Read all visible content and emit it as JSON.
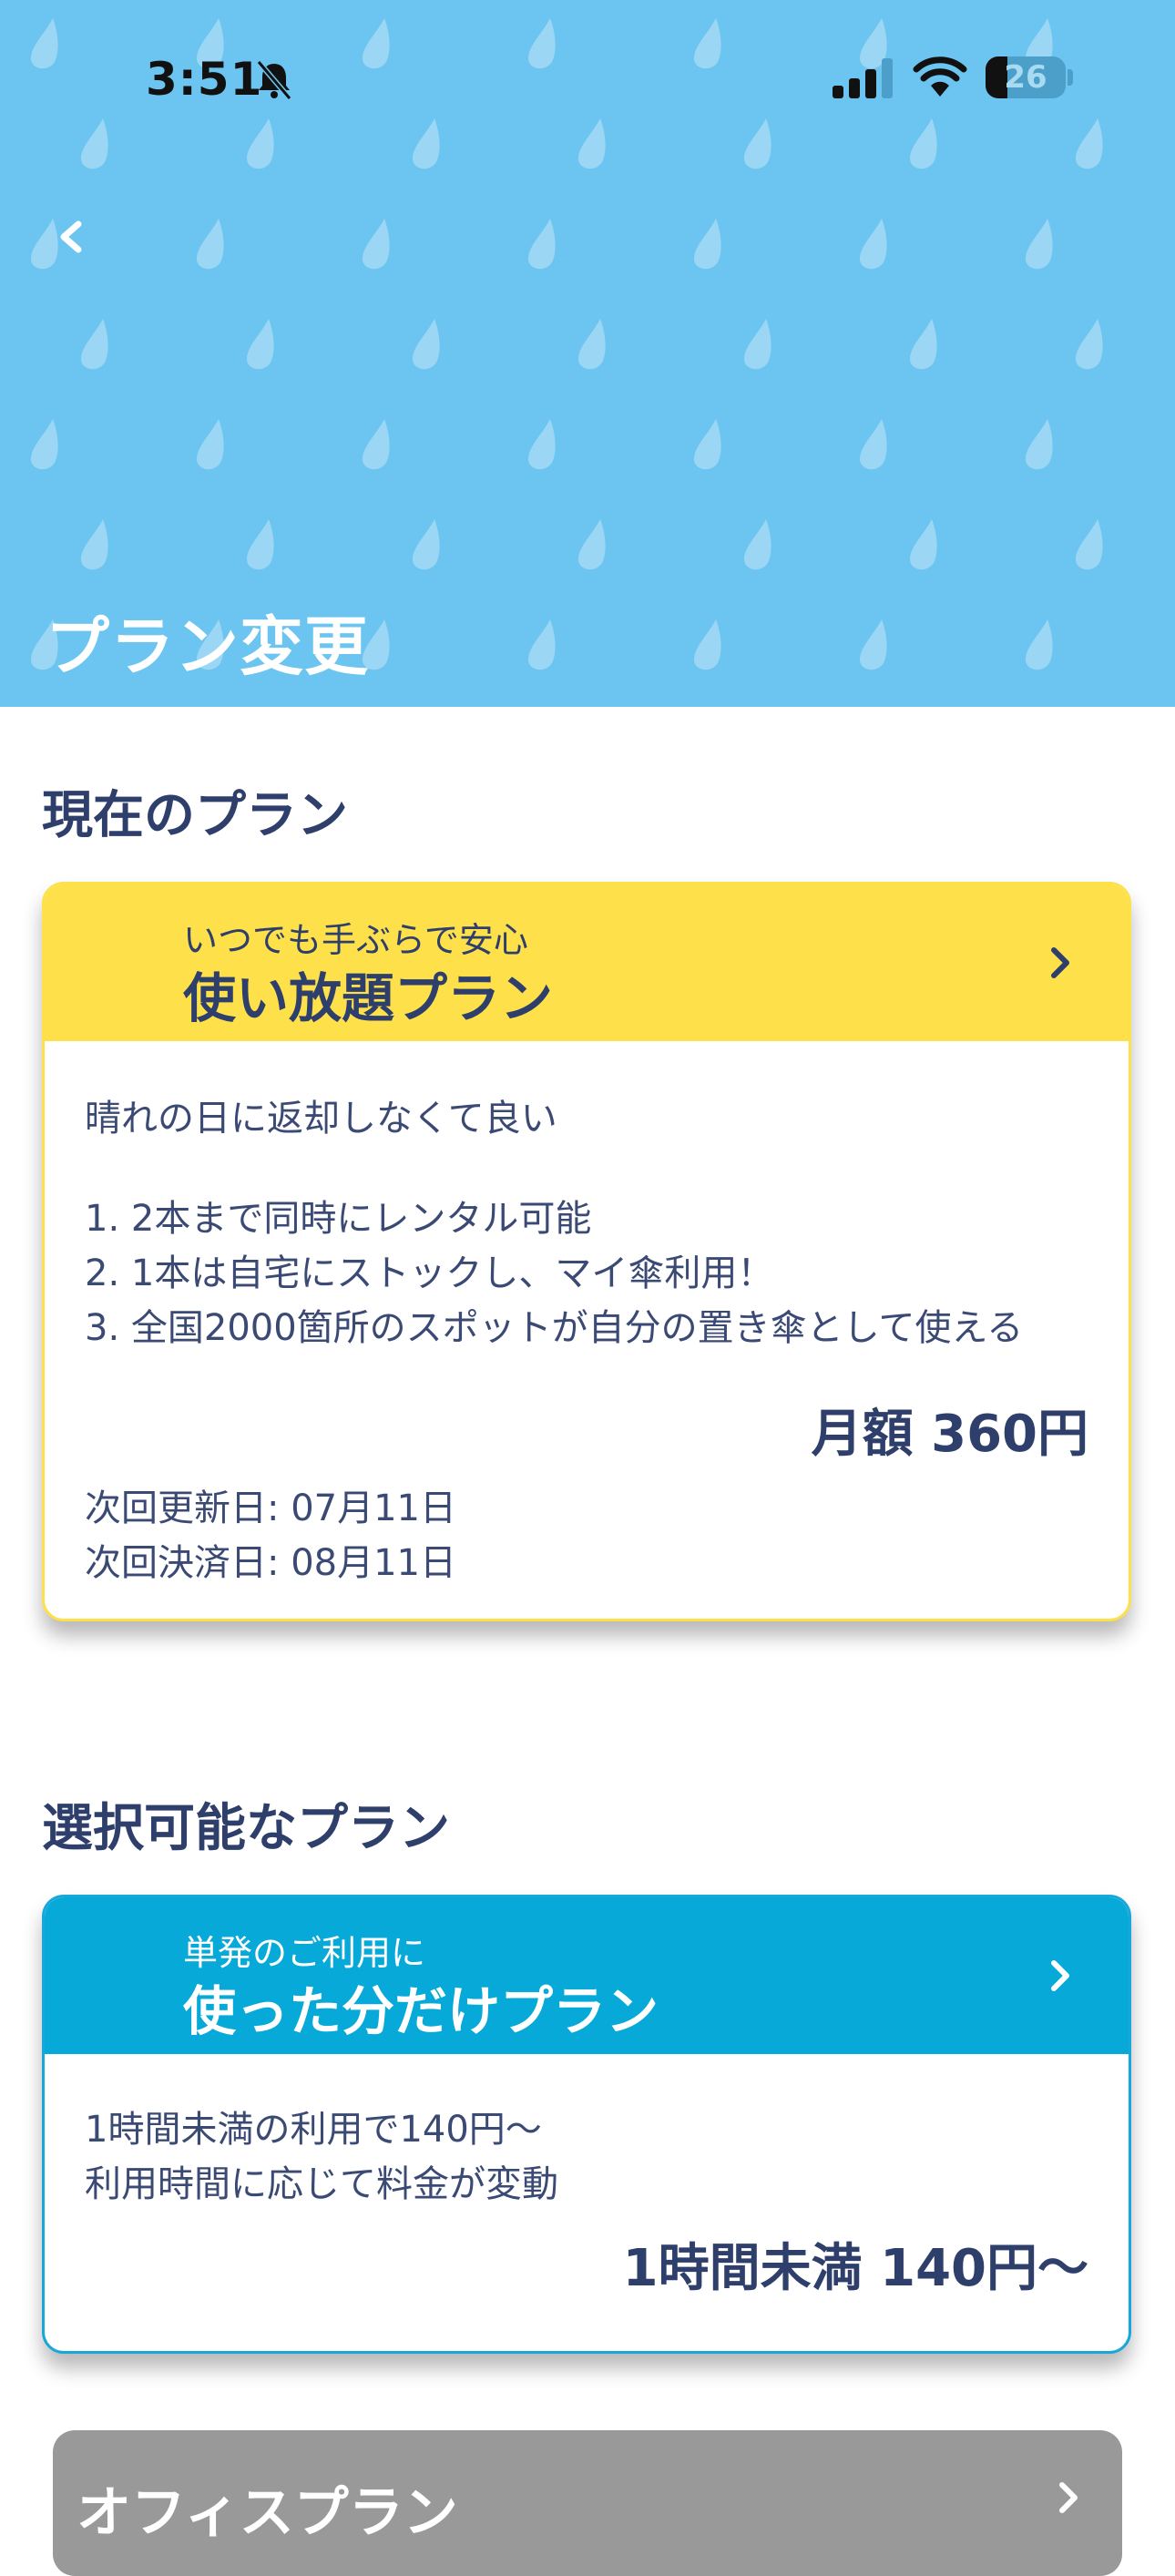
{
  "status_bar": {
    "time": "3:51",
    "battery": "26"
  },
  "header": {
    "title": "プラン変更"
  },
  "current_section": {
    "heading": "現在のプラン",
    "plan": {
      "subtitle": "いつでも手ぶらで安心",
      "name": "使い放題プラン",
      "tagline": "晴れの日に返却しなくて良い",
      "features": [
        "1.  2本まで同時にレンタル可能",
        "2.  1本は自宅にストックし、マイ傘利用！",
        "3.  全国2000箇所のスポットが自分の置き傘として使える"
      ],
      "price": "月額 360円",
      "next_renewal": "次回更新日: 07月11日",
      "next_payment": "次回決済日: 08月11日"
    }
  },
  "available_section": {
    "heading": "選択可能なプラン",
    "plans": [
      {
        "subtitle": "単発のご利用に",
        "name": "使った分だけプラン",
        "lines": [
          "1時間未満の利用で140円〜",
          "利用時間に応じて料金が変動"
        ],
        "price": "1時間未満 140円〜"
      },
      {
        "name": "オフィスプラン"
      }
    ]
  },
  "colors": {
    "header_bg": "#6cc5f0",
    "current_plan_accent": "#fde04a",
    "payg_plan_accent": "#06a9d8",
    "office_plan_bg": "#999999",
    "text_navy": "#2f3f6b"
  },
  "icons": [
    "bell-slash-icon",
    "cell-signal-icon",
    "wifi-icon",
    "battery-icon",
    "back-chevron-icon",
    "chevron-right-icon"
  ]
}
